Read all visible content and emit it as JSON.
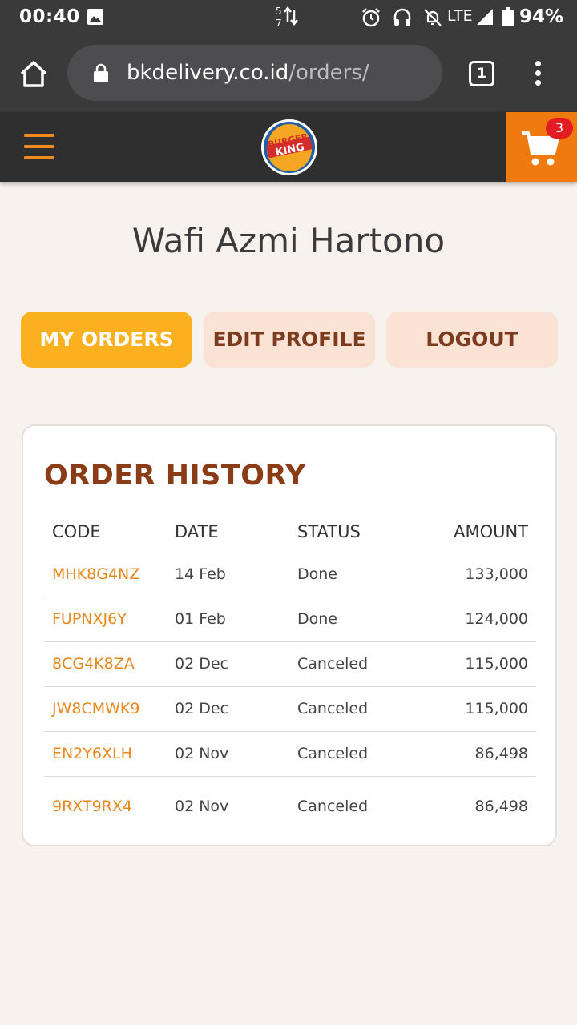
{
  "status_bar": {
    "time": "00:40",
    "data_up": "5",
    "data_down": "7",
    "network": "LTE",
    "battery": "94%"
  },
  "browser": {
    "url_host": "bkdelivery.co.id",
    "url_path": "/orders/",
    "tab_count": "1"
  },
  "header": {
    "logo_top": "BURGER",
    "logo_bottom": "KING",
    "cart_count": "3"
  },
  "profile": {
    "name": "Wafi Azmi Hartono"
  },
  "tabs": {
    "my_orders": "MY ORDERS",
    "edit_profile": "EDIT PROFILE",
    "logout": "LOGOUT"
  },
  "orders": {
    "title": "ORDER HISTORY",
    "columns": {
      "code": "CODE",
      "date": "DATE",
      "status": "STATUS",
      "amount": "AMOUNT"
    },
    "rows": [
      {
        "code": "MHK8G4NZ",
        "date": "14 Feb",
        "status": "Done",
        "amount": "133,000"
      },
      {
        "code": "FUPNXJ6Y",
        "date": "01 Feb",
        "status": "Done",
        "amount": "124,000"
      },
      {
        "code": "8CG4K8ZA",
        "date": "02 Dec",
        "status": "Canceled",
        "amount": "115,000"
      },
      {
        "code": "JW8CMWK9",
        "date": "02 Dec",
        "status": "Canceled",
        "amount": "115,000"
      },
      {
        "code": "EN2Y6XLH",
        "date": "02 Nov",
        "status": "Canceled",
        "amount": "86,498"
      },
      {
        "code": "9RXT9RX4",
        "date": "02 Nov",
        "status": "Canceled",
        "amount": "86,498"
      }
    ]
  },
  "colors": {
    "accent_orange": "#ee7a10",
    "active_tab": "#fbb11f",
    "inactive_tab": "#fae2d5",
    "title_brown": "#8a3c17",
    "code_orange": "#e8871b"
  },
  "icons": {
    "home": "home-icon",
    "lock": "lock-icon",
    "menu": "more-vert-icon",
    "hamburger": "hamburger-menu-icon",
    "cart": "shopping-cart-icon"
  }
}
